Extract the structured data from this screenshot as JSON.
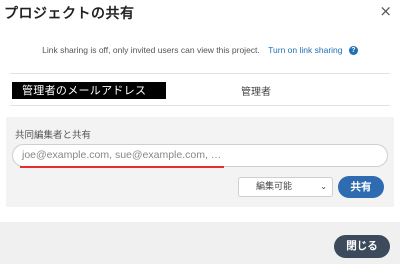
{
  "dialog": {
    "title": "プロジェクトの共有",
    "close_glyph": "×"
  },
  "link_sharing": {
    "status_text": "Link sharing is off, only invited users can view this project.",
    "turn_on_label": "Turn on link sharing",
    "help_glyph": "?"
  },
  "owner": {
    "email": "管理者のメールアドレス",
    "role": "管理者"
  },
  "share": {
    "label": "共同編集者と共有",
    "placeholder": "joe@example.com, sue@example.com, …",
    "permission": "編集可能",
    "permission_chevron": "⌄",
    "share_button": "共有"
  },
  "footer": {
    "close_button": "閉じる"
  }
}
